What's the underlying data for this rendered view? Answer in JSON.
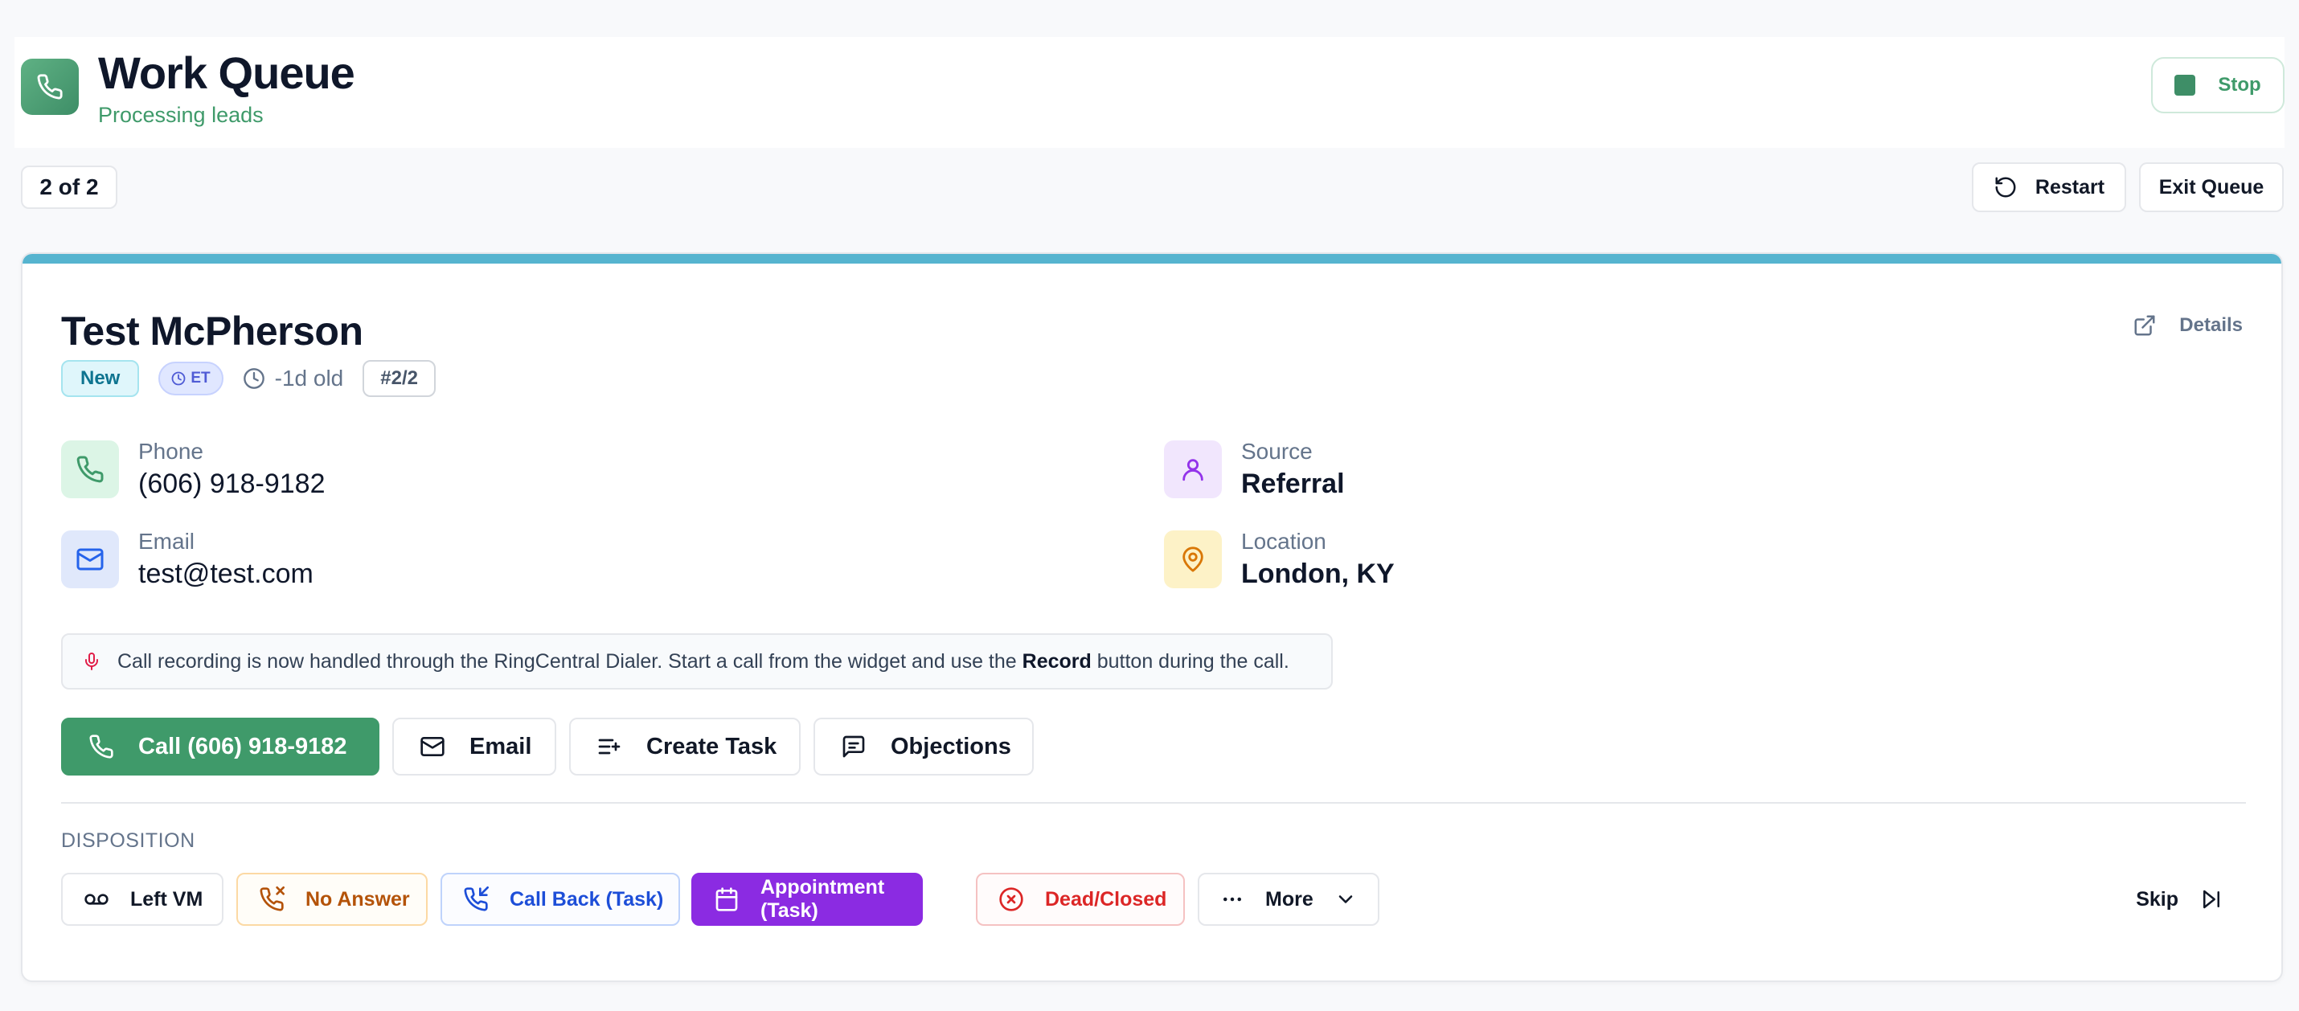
{
  "header": {
    "title": "Work Queue",
    "subtitle": "Processing leads",
    "stop_label": "Stop"
  },
  "toolbar": {
    "counter": "2 of 2",
    "restart_label": "Restart",
    "exit_label": "Exit Queue"
  },
  "lead": {
    "name": "Test McPherson",
    "details_label": "Details",
    "status_badge": "New",
    "timezone_badge": "ET",
    "age": "-1d old",
    "position_badge": "#2/2",
    "fields": {
      "phone_label": "Phone",
      "phone_value": "(606) 918-9182",
      "email_label": "Email",
      "email_value": "test@test.com",
      "source_label": "Source",
      "source_value": "Referral",
      "location_label": "Location",
      "location_value": "London, KY"
    },
    "notice": {
      "text_before": "Call recording is now handled through the RingCentral Dialer. Start a call from the widget and use the",
      "emphasis": "Record",
      "text_after": "button during the call."
    }
  },
  "actions": {
    "call_label": "Call (606) 918-9182",
    "email_label": "Email",
    "create_task_label": "Create Task",
    "objections_label": "Objections"
  },
  "disposition": {
    "section_label": "DISPOSITION",
    "left_vm": "Left VM",
    "no_answer": "No Answer",
    "call_back": "Call Back (Task)",
    "appointment": "Appointment (Task)",
    "dead_closed": "Dead/Closed",
    "more": "More",
    "skip": "Skip"
  },
  "colors": {
    "brand_green": "#3f9a6a",
    "card_accent": "#56b4cf",
    "appointment_purple": "#8b2be2",
    "no_answer_amber": "#b45309",
    "call_back_blue": "#1d4ed8",
    "dead_red": "#dc2626"
  },
  "icons": {
    "app": "phone-icon",
    "restart": "rotate-ccw-icon",
    "details": "external-link-icon",
    "timezone": "clock-icon",
    "phone": "phone-icon",
    "email": "mail-icon",
    "source": "user-icon",
    "location": "map-pin-icon",
    "notice": "microphone-icon",
    "create_task": "list-plus-icon",
    "objections": "message-square-icon",
    "left_vm": "voicemail-icon",
    "no_answer": "phone-missed-icon",
    "call_back": "phone-incoming-icon",
    "appointment": "calendar-icon",
    "dead_closed": "x-circle-icon",
    "more": "ellipsis-icon",
    "skip": "skip-forward-icon"
  }
}
